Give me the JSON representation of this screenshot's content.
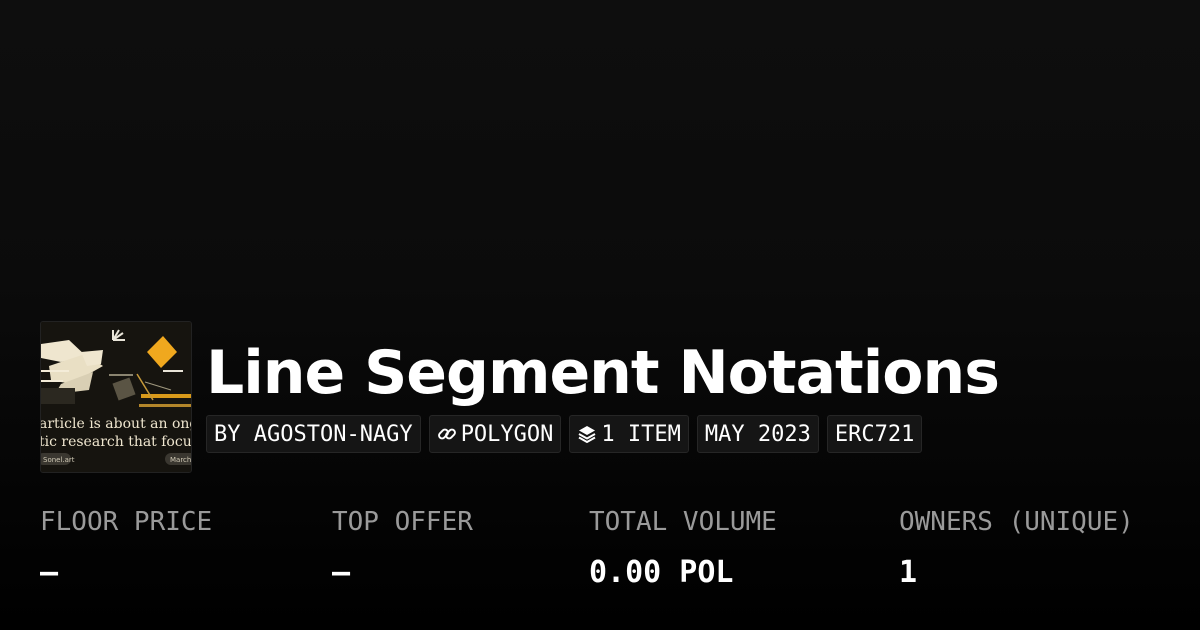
{
  "collection": {
    "title": "Line Segment Notations",
    "thumbnail": {
      "caption_line1": "article is about an ongoin",
      "caption_line2": "tic research that focuses o",
      "footer_left": "Sonel.art",
      "footer_right": "March"
    }
  },
  "tags": {
    "creator": "BY AGOSTON-NAGY",
    "chain": "POLYGON",
    "chain_icon": "link-icon",
    "items": "1 ITEM",
    "items_icon": "layers-icon",
    "date": "MAY 2023",
    "standard": "ERC721"
  },
  "stats": {
    "floor_price": {
      "label": "FLOOR PRICE",
      "value": "—"
    },
    "top_offer": {
      "label": "TOP OFFER",
      "value": "—"
    },
    "total_volume": {
      "label": "TOTAL VOLUME",
      "value": "0.00 POL"
    },
    "owners": {
      "label": "OWNERS (UNIQUE)",
      "value": "1"
    }
  },
  "colors": {
    "background": "#0b0b0b",
    "accent_orange": "#f0a81e",
    "label_gray": "#9a9a9a"
  }
}
